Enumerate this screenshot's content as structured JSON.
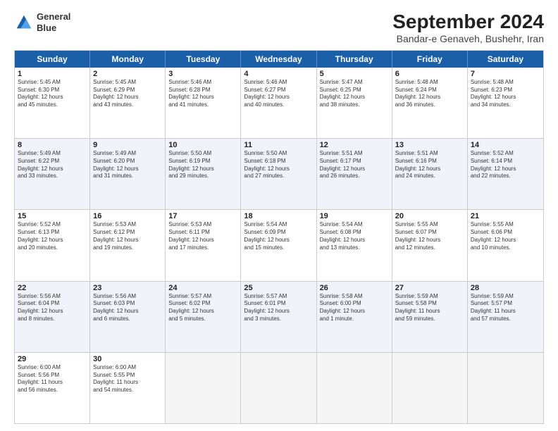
{
  "logo": {
    "line1": "General",
    "line2": "Blue"
  },
  "title": "September 2024",
  "subtitle": "Bandar-e Genaveh, Bushehr, Iran",
  "days": [
    "Sunday",
    "Monday",
    "Tuesday",
    "Wednesday",
    "Thursday",
    "Friday",
    "Saturday"
  ],
  "rows": [
    [
      {
        "day": "",
        "text": ""
      },
      {
        "day": "2",
        "text": "Sunrise: 5:45 AM\nSunset: 6:29 PM\nDaylight: 12 hours\nand 43 minutes."
      },
      {
        "day": "3",
        "text": "Sunrise: 5:46 AM\nSunset: 6:28 PM\nDaylight: 12 hours\nand 41 minutes."
      },
      {
        "day": "4",
        "text": "Sunrise: 5:46 AM\nSunset: 6:27 PM\nDaylight: 12 hours\nand 40 minutes."
      },
      {
        "day": "5",
        "text": "Sunrise: 5:47 AM\nSunset: 6:25 PM\nDaylight: 12 hours\nand 38 minutes."
      },
      {
        "day": "6",
        "text": "Sunrise: 5:48 AM\nSunset: 6:24 PM\nDaylight: 12 hours\nand 36 minutes."
      },
      {
        "day": "7",
        "text": "Sunrise: 5:48 AM\nSunset: 6:23 PM\nDaylight: 12 hours\nand 34 minutes."
      }
    ],
    [
      {
        "day": "8",
        "text": "Sunrise: 5:49 AM\nSunset: 6:22 PM\nDaylight: 12 hours\nand 33 minutes."
      },
      {
        "day": "9",
        "text": "Sunrise: 5:49 AM\nSunset: 6:20 PM\nDaylight: 12 hours\nand 31 minutes."
      },
      {
        "day": "10",
        "text": "Sunrise: 5:50 AM\nSunset: 6:19 PM\nDaylight: 12 hours\nand 29 minutes."
      },
      {
        "day": "11",
        "text": "Sunrise: 5:50 AM\nSunset: 6:18 PM\nDaylight: 12 hours\nand 27 minutes."
      },
      {
        "day": "12",
        "text": "Sunrise: 5:51 AM\nSunset: 6:17 PM\nDaylight: 12 hours\nand 26 minutes."
      },
      {
        "day": "13",
        "text": "Sunrise: 5:51 AM\nSunset: 6:16 PM\nDaylight: 12 hours\nand 24 minutes."
      },
      {
        "day": "14",
        "text": "Sunrise: 5:52 AM\nSunset: 6:14 PM\nDaylight: 12 hours\nand 22 minutes."
      }
    ],
    [
      {
        "day": "15",
        "text": "Sunrise: 5:52 AM\nSunset: 6:13 PM\nDaylight: 12 hours\nand 20 minutes."
      },
      {
        "day": "16",
        "text": "Sunrise: 5:53 AM\nSunset: 6:12 PM\nDaylight: 12 hours\nand 19 minutes."
      },
      {
        "day": "17",
        "text": "Sunrise: 5:53 AM\nSunset: 6:11 PM\nDaylight: 12 hours\nand 17 minutes."
      },
      {
        "day": "18",
        "text": "Sunrise: 5:54 AM\nSunset: 6:09 PM\nDaylight: 12 hours\nand 15 minutes."
      },
      {
        "day": "19",
        "text": "Sunrise: 5:54 AM\nSunset: 6:08 PM\nDaylight: 12 hours\nand 13 minutes."
      },
      {
        "day": "20",
        "text": "Sunrise: 5:55 AM\nSunset: 6:07 PM\nDaylight: 12 hours\nand 12 minutes."
      },
      {
        "day": "21",
        "text": "Sunrise: 5:55 AM\nSunset: 6:06 PM\nDaylight: 12 hours\nand 10 minutes."
      }
    ],
    [
      {
        "day": "22",
        "text": "Sunrise: 5:56 AM\nSunset: 6:04 PM\nDaylight: 12 hours\nand 8 minutes."
      },
      {
        "day": "23",
        "text": "Sunrise: 5:56 AM\nSunset: 6:03 PM\nDaylight: 12 hours\nand 6 minutes."
      },
      {
        "day": "24",
        "text": "Sunrise: 5:57 AM\nSunset: 6:02 PM\nDaylight: 12 hours\nand 5 minutes."
      },
      {
        "day": "25",
        "text": "Sunrise: 5:57 AM\nSunset: 6:01 PM\nDaylight: 12 hours\nand 3 minutes."
      },
      {
        "day": "26",
        "text": "Sunrise: 5:58 AM\nSunset: 6:00 PM\nDaylight: 12 hours\nand 1 minute."
      },
      {
        "day": "27",
        "text": "Sunrise: 5:59 AM\nSunset: 5:58 PM\nDaylight: 11 hours\nand 59 minutes."
      },
      {
        "day": "28",
        "text": "Sunrise: 5:59 AM\nSunset: 5:57 PM\nDaylight: 11 hours\nand 57 minutes."
      }
    ],
    [
      {
        "day": "29",
        "text": "Sunrise: 6:00 AM\nSunset: 5:56 PM\nDaylight: 11 hours\nand 56 minutes."
      },
      {
        "day": "30",
        "text": "Sunrise: 6:00 AM\nSunset: 5:55 PM\nDaylight: 11 hours\nand 54 minutes."
      },
      {
        "day": "",
        "text": ""
      },
      {
        "day": "",
        "text": ""
      },
      {
        "day": "",
        "text": ""
      },
      {
        "day": "",
        "text": ""
      },
      {
        "day": "",
        "text": ""
      }
    ]
  ],
  "row1_col1": {
    "day": "1",
    "text": "Sunrise: 5:45 AM\nSunset: 6:30 PM\nDaylight: 12 hours\nand 45 minutes."
  }
}
